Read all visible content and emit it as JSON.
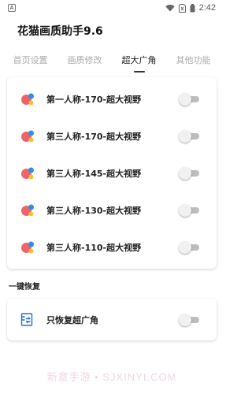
{
  "status_bar": {
    "app_icon_letter": "A",
    "time": "2:42"
  },
  "app": {
    "title": "花猫画质助手9.6"
  },
  "tabs": [
    {
      "label": "首页设置",
      "active": false
    },
    {
      "label": "画质修改",
      "active": false
    },
    {
      "label": "超大广角",
      "active": true
    },
    {
      "label": "其他功能",
      "active": false
    }
  ],
  "view_options": [
    {
      "label": "第一人称-170-超大视野",
      "enabled": false
    },
    {
      "label": "第三人称-170-超大视野",
      "enabled": false
    },
    {
      "label": "第三人称-145-超大视野",
      "enabled": false
    },
    {
      "label": "第三人称-130-超大视野",
      "enabled": false
    },
    {
      "label": "第三人称-110-超大视野",
      "enabled": false
    }
  ],
  "restore_section": {
    "title": "一键恢复",
    "option": {
      "label": "只恢复超广角",
      "enabled": false
    }
  },
  "watermark": "新意手游 • SJXINYI.COM",
  "colors": {
    "icon_red": "#f0636a",
    "icon_blue": "#2f8de4",
    "icon_yellow": "#f5c42c",
    "restore_icon_blue": "#1f6fd6",
    "switch_track": "#bdbdbd",
    "switch_thumb": "#f1f1f1"
  }
}
